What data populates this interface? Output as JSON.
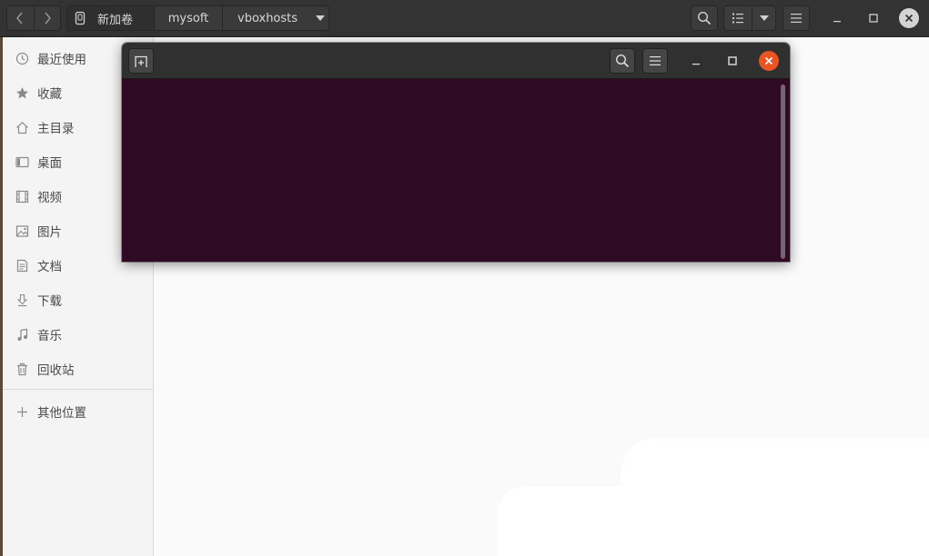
{
  "file_manager": {
    "path": {
      "root_label": "新加卷",
      "middle_label": "mysoft",
      "current_label": "vboxhosts"
    },
    "icons": {
      "back": "chevron-left-icon",
      "forward": "chevron-right-icon",
      "drive": "drive-icon",
      "search": "search-icon",
      "view": "list-view-icon",
      "view_options": "caret-down-icon",
      "menu": "hamburger-menu-icon"
    }
  },
  "sidebar": {
    "items": [
      {
        "label": "最近使用",
        "icon": "clock-icon"
      },
      {
        "label": "收藏",
        "icon": "star-icon"
      },
      {
        "label": "主目录",
        "icon": "home-icon"
      },
      {
        "label": "桌面",
        "icon": "desktop-icon"
      },
      {
        "label": "视频",
        "icon": "video-icon"
      },
      {
        "label": "图片",
        "icon": "image-icon"
      },
      {
        "label": "文档",
        "icon": "document-icon"
      },
      {
        "label": "下载",
        "icon": "download-icon"
      },
      {
        "label": "音乐",
        "icon": "music-icon"
      },
      {
        "label": "回收站",
        "icon": "trash-icon"
      }
    ],
    "other_locations": {
      "label": "其他位置",
      "icon": "plus-icon"
    }
  },
  "terminal": {
    "background_color": "#300a24",
    "accent_close_color": "#e95420"
  }
}
